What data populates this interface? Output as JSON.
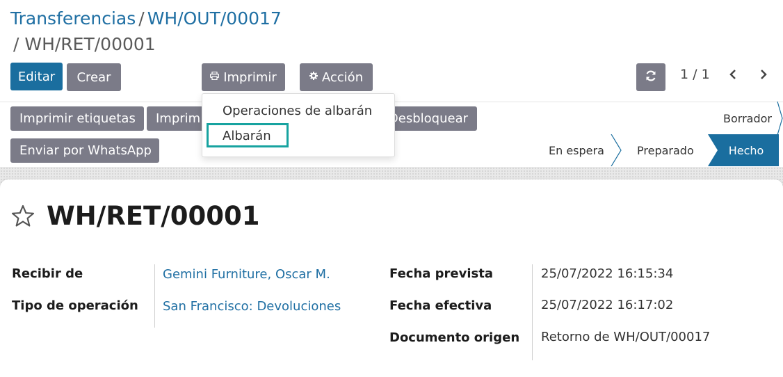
{
  "breadcrumb": {
    "items": [
      "Transferencias",
      "WH/OUT/00017"
    ],
    "separator": "/",
    "current": "/ WH/RET/00001"
  },
  "toolbar": {
    "edit_label": "Editar",
    "create_label": "Crear",
    "print_label": "Imprimir",
    "action_label": "Acción"
  },
  "pager": {
    "value": "1 / 1"
  },
  "dropdown": {
    "items": [
      "Operaciones de albarán",
      "Albarán"
    ],
    "highlighted": "Albarán"
  },
  "statusbar": {
    "buttons": [
      "Imprimir etiquetas",
      "Imprim",
      "Desbloquear",
      "Enviar por WhatsApp"
    ],
    "stages": [
      "Borrador",
      "En espera",
      "Preparado",
      "Hecho"
    ],
    "active_stage": "Hecho"
  },
  "record": {
    "title": "WH/RET/00001",
    "fields_left": [
      {
        "label": "Recibir de",
        "value": "Gemini Furniture, Oscar M."
      },
      {
        "label": "Tipo de operación",
        "value": "San Francisco: Devoluciones"
      }
    ],
    "fields_right": [
      {
        "label": "Fecha prevista",
        "value": "25/07/2022 16:15:34"
      },
      {
        "label": "Fecha efectiva",
        "value": "25/07/2022 16:17:02"
      },
      {
        "label": "Documento origen",
        "value": "Retorno de WH/OUT/00017"
      }
    ]
  },
  "colors": {
    "primary": "#1a6e9f",
    "secondary": "#7b7b88",
    "link": "#1f6fa3",
    "highlight": "#17a3a0"
  }
}
